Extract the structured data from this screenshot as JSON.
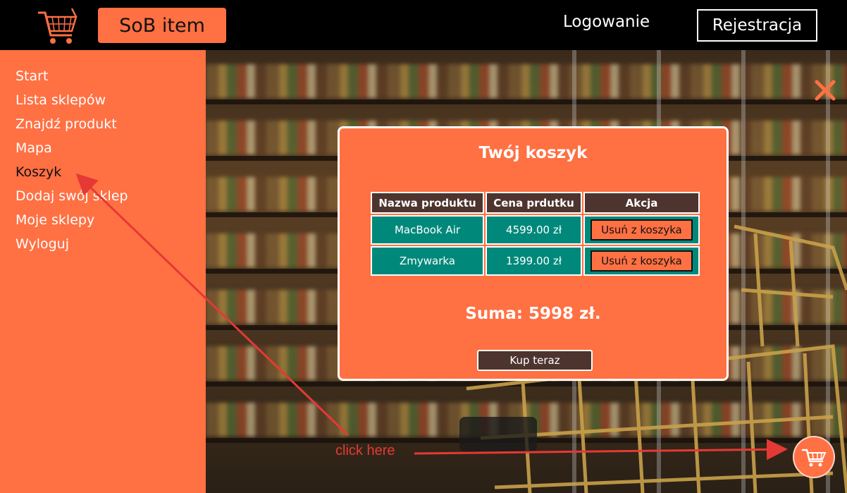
{
  "header": {
    "logo_icon": "shopping-cart-icon",
    "brand": "SoB item",
    "login": "Logowanie",
    "register": "Rejestracja"
  },
  "sidebar": {
    "items": [
      {
        "label": "Start"
      },
      {
        "label": "Lista sklepów"
      },
      {
        "label": "Znajdź produkt"
      },
      {
        "label": "Mapa"
      },
      {
        "label": "Koszyk"
      },
      {
        "label": "Dodaj swój sklep"
      },
      {
        "label": "Moje sklepy"
      },
      {
        "label": "Wyloguj"
      }
    ],
    "active_index": 4
  },
  "cart_modal": {
    "title": "Twój koszyk",
    "columns": [
      "Nazwa produktu",
      "Cena prdutku",
      "Akcja"
    ],
    "rows": [
      {
        "name": "MacBook Air",
        "price": "4599.00 zł",
        "action": "Usuń z koszyka"
      },
      {
        "name": "Zmywarka",
        "price": "1399.00 zł",
        "action": "Usuń z koszyka"
      }
    ],
    "sum": "Suma: 5998 zł.",
    "buy": "Kup teraz"
  },
  "annotation": {
    "text": "click here"
  },
  "colors": {
    "accent": "#ff7043",
    "table_header": "#4e342e",
    "table_cell": "#00897b",
    "annotation": "#e53935"
  }
}
